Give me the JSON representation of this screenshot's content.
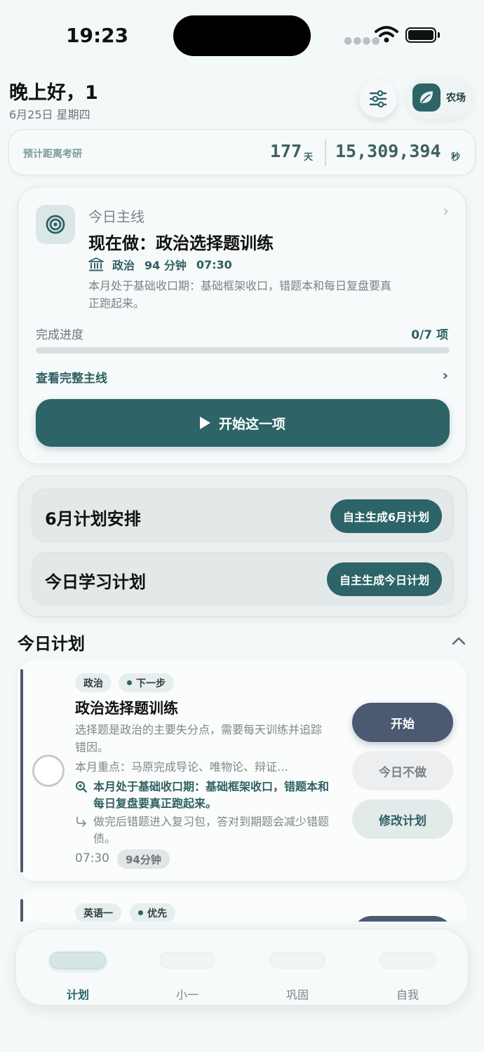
{
  "status_bar": {
    "time": "19:23"
  },
  "header": {
    "greeting": "晚上好，1",
    "date": "6月25日 星期四",
    "farm_label": "农场"
  },
  "countdown": {
    "label": "预计距离考研",
    "days": "177",
    "days_unit": "天",
    "seconds": "15,309,394",
    "seconds_unit": "秒"
  },
  "main_card": {
    "kicker": "今日主线",
    "title": "现在做：政治选择题训练",
    "subject": "政治",
    "duration": "94 分钟",
    "time": "07:30",
    "description": "本月处于基础收口期：基础框架收口，错题本和每日复盘要真正跑起来。",
    "progress_label": "完成进度",
    "progress_count": "0/7 项",
    "progress_fraction": 0,
    "view_all": "查看完整主线",
    "start_button": "开始这一项"
  },
  "plan_block": {
    "month_title": "6月计划安排",
    "month_button": "自主生成6月计划",
    "day_title": "今日学习计划",
    "day_button": "自主生成今日计划"
  },
  "today": {
    "title": "今日计划",
    "tasks": [
      {
        "tag_subject": "政治",
        "tag_status": "下一步",
        "title": "政治选择题训练",
        "description": "选择题是政治的主要失分点，需要每天训练并追踪错因。",
        "focus": "本月重点：马原完成导论、唯物论、辩证…",
        "tip": "本月处于基础收口期：基础框架收口，错题本和每日复盘要真正跑起来。",
        "next": "做完后错题进入复习包，答对到期题会减少错题债。",
        "time": "07:30",
        "duration": "94分钟",
        "btn_start": "开始",
        "btn_skip": "今日不做",
        "btn_edit": "修改计划"
      },
      {
        "tag_subject": "英语一",
        "tag_status": "优先"
      }
    ]
  },
  "tabbar": {
    "tabs": [
      "计划",
      "小一",
      "巩固",
      "自我"
    ],
    "active": 0
  },
  "colors": {
    "accent": "#2c6467",
    "slate": "#4b5a70",
    "background": "#f3f8f8"
  }
}
